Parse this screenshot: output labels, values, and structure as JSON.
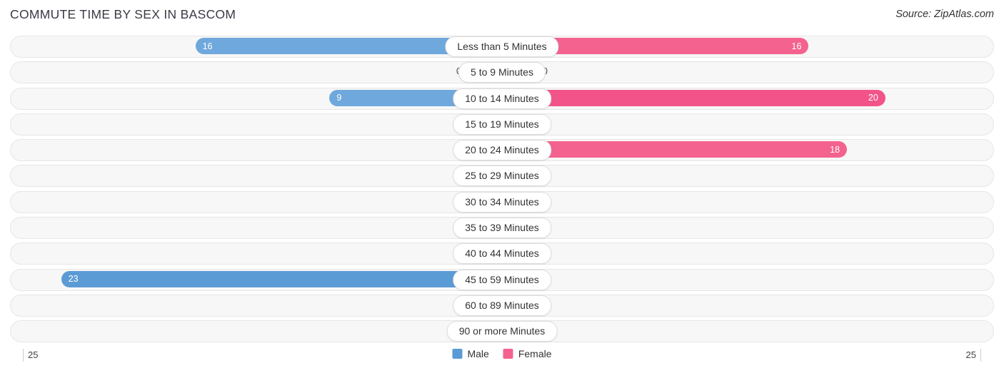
{
  "header": {
    "title": "COMMUTE TIME BY SEX IN BASCOM",
    "source": "Source: ZipAtlas.com"
  },
  "legend": {
    "items": [
      {
        "label": "Male",
        "color": "#5b9bd5"
      },
      {
        "label": "Female",
        "color": "#f4628f"
      }
    ]
  },
  "axis": {
    "left_label": "25",
    "right_label": "25"
  },
  "colors": {
    "male": "#6fa8dc",
    "male_strong": "#5b9bd5",
    "male_light": "#aac8ec",
    "female": "#f4628f",
    "female_strong": "#f2548a",
    "female_light": "#f7a3bf",
    "track": "#f7f7f7",
    "track_border": "#e6e6e6"
  },
  "chart_data": {
    "type": "bar",
    "title": "COMMUTE TIME BY SEX IN BASCOM",
    "subtitle": "Source: ZipAtlas.com",
    "orientation": "horizontal-diverging",
    "xlabel": "",
    "ylabel": "",
    "xlim": [
      25,
      25
    ],
    "grid": false,
    "legend_position": "bottom-center",
    "categories": [
      "Less than 5 Minutes",
      "5 to 9 Minutes",
      "10 to 14 Minutes",
      "15 to 19 Minutes",
      "20 to 24 Minutes",
      "25 to 29 Minutes",
      "30 to 34 Minutes",
      "35 to 39 Minutes",
      "40 to 44 Minutes",
      "45 to 59 Minutes",
      "60 to 89 Minutes",
      "90 or more Minutes"
    ],
    "series": [
      {
        "name": "Male",
        "values": [
          16,
          0,
          9,
          0,
          0,
          0,
          0,
          0,
          0,
          23,
          0,
          0
        ]
      },
      {
        "name": "Female",
        "values": [
          16,
          0,
          20,
          0,
          18,
          0,
          0,
          0,
          0,
          0,
          0,
          0
        ]
      }
    ]
  },
  "rows": [
    {
      "label": "Less than 5 Minutes",
      "male": "16",
      "female": "16"
    },
    {
      "label": "5 to 9 Minutes",
      "male": "0",
      "female": "0"
    },
    {
      "label": "10 to 14 Minutes",
      "male": "9",
      "female": "20"
    },
    {
      "label": "15 to 19 Minutes",
      "male": "0",
      "female": "0"
    },
    {
      "label": "20 to 24 Minutes",
      "male": "0",
      "female": "18"
    },
    {
      "label": "25 to 29 Minutes",
      "male": "0",
      "female": "0"
    },
    {
      "label": "30 to 34 Minutes",
      "male": "0",
      "female": "0"
    },
    {
      "label": "35 to 39 Minutes",
      "male": "0",
      "female": "0"
    },
    {
      "label": "40 to 44 Minutes",
      "male": "0",
      "female": "0"
    },
    {
      "label": "45 to 59 Minutes",
      "male": "23",
      "female": "0"
    },
    {
      "label": "60 to 89 Minutes",
      "male": "0",
      "female": "0"
    },
    {
      "label": "90 or more Minutes",
      "male": "0",
      "female": "0"
    }
  ]
}
